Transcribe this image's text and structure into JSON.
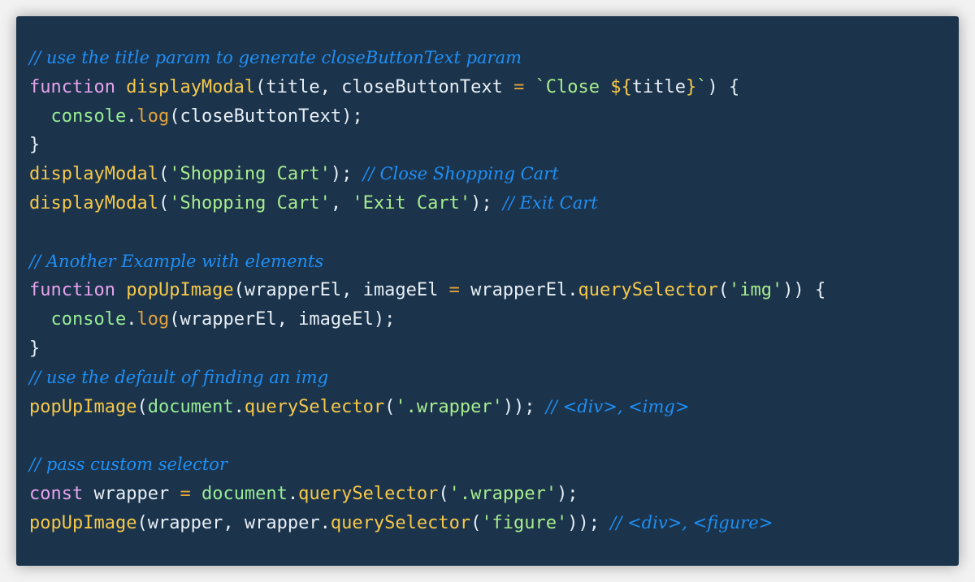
{
  "colors": {
    "background": "#1b344c",
    "page": "#f2f2f2",
    "plain": "#e7eef5",
    "keyword": "#e7a2ec",
    "function": "#f6c84a",
    "string": "#a8ec8d",
    "object": "#98ec95",
    "operator": "#e3a33d",
    "comment": "#1f8ff5"
  },
  "code": {
    "lines": [
      [
        [
          "cm",
          "// use the title param to generate closeButtonText param"
        ]
      ],
      [
        [
          "kw",
          "function"
        ],
        [
          "plain",
          " "
        ],
        [
          "fn",
          "displayModal"
        ],
        [
          "plain",
          "(title, closeButtonText "
        ],
        [
          "op",
          "="
        ],
        [
          "plain",
          " "
        ],
        [
          "str",
          "`Close "
        ],
        [
          "interp",
          "${"
        ],
        [
          "plain",
          "title"
        ],
        [
          "interp",
          "}"
        ],
        [
          "str",
          "`"
        ],
        [
          "plain",
          ") {"
        ]
      ],
      [
        [
          "plain",
          "  "
        ],
        [
          "obj",
          "console"
        ],
        [
          "plain",
          "."
        ],
        [
          "op",
          "log"
        ],
        [
          "plain",
          "(closeButtonText);"
        ]
      ],
      [
        [
          "plain",
          "}"
        ]
      ],
      [
        [
          "fn",
          "displayModal"
        ],
        [
          "plain",
          "("
        ],
        [
          "str",
          "'Shopping Cart'"
        ],
        [
          "plain",
          "); "
        ],
        [
          "cm",
          "// Close Shopping Cart"
        ]
      ],
      [
        [
          "fn",
          "displayModal"
        ],
        [
          "plain",
          "("
        ],
        [
          "str",
          "'Shopping Cart'"
        ],
        [
          "plain",
          ", "
        ],
        [
          "str",
          "'Exit Cart'"
        ],
        [
          "plain",
          "); "
        ],
        [
          "cm",
          "// Exit Cart"
        ]
      ],
      [],
      [
        [
          "cm",
          "// Another Example with elements"
        ]
      ],
      [
        [
          "kw",
          "function"
        ],
        [
          "plain",
          " "
        ],
        [
          "fn",
          "popUpImage"
        ],
        [
          "plain",
          "(wrapperEl, imageEl "
        ],
        [
          "op",
          "="
        ],
        [
          "plain",
          " wrapperEl."
        ],
        [
          "fn",
          "querySelector"
        ],
        [
          "plain",
          "("
        ],
        [
          "str",
          "'img'"
        ],
        [
          "plain",
          ")) {"
        ]
      ],
      [
        [
          "plain",
          "  "
        ],
        [
          "obj",
          "console"
        ],
        [
          "plain",
          "."
        ],
        [
          "op",
          "log"
        ],
        [
          "plain",
          "(wrapperEl, imageEl);"
        ]
      ],
      [
        [
          "plain",
          "}"
        ]
      ],
      [
        [
          "cm",
          "// use the default of finding an img"
        ]
      ],
      [
        [
          "fn",
          "popUpImage"
        ],
        [
          "plain",
          "("
        ],
        [
          "obj",
          "document"
        ],
        [
          "plain",
          "."
        ],
        [
          "fn",
          "querySelector"
        ],
        [
          "plain",
          "("
        ],
        [
          "str",
          "'.wrapper'"
        ],
        [
          "plain",
          ")); "
        ],
        [
          "cm",
          "// <div>, <img>"
        ]
      ],
      [],
      [
        [
          "cm",
          "// pass custom selector"
        ]
      ],
      [
        [
          "kw",
          "const"
        ],
        [
          "plain",
          " wrapper "
        ],
        [
          "op",
          "="
        ],
        [
          "plain",
          " "
        ],
        [
          "obj",
          "document"
        ],
        [
          "plain",
          "."
        ],
        [
          "fn",
          "querySelector"
        ],
        [
          "plain",
          "("
        ],
        [
          "str",
          "'.wrapper'"
        ],
        [
          "plain",
          ");"
        ]
      ],
      [
        [
          "fn",
          "popUpImage"
        ],
        [
          "plain",
          "(wrapper, wrapper."
        ],
        [
          "fn",
          "querySelector"
        ],
        [
          "plain",
          "("
        ],
        [
          "str",
          "'figure'"
        ],
        [
          "plain",
          ")); "
        ],
        [
          "cm",
          "// <div>, <figure>"
        ]
      ]
    ]
  }
}
